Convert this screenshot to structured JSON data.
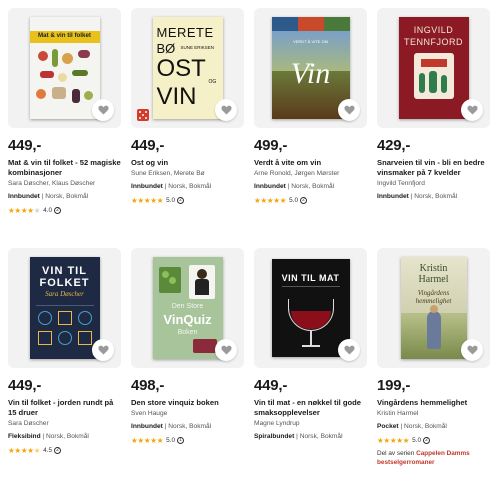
{
  "products": [
    {
      "price": "449,-",
      "title": "Mat & vin til folket - 52 magiske kombinasjoner",
      "authors": "Sara Døscher, Klaus Døscher",
      "format": "Innbundet",
      "language": "Norsk, Bokmål",
      "rating": "4.0",
      "rating_count": "2",
      "stars_filled": 4,
      "cover": {
        "title": "Mat & vin til folket",
        "bg": "#f4f4f0",
        "accent": "#e8c21a"
      }
    },
    {
      "price": "449,-",
      "title": "Ost og vin",
      "authors": "Sune Eriksen, Merete Bø",
      "format": "Innbundet",
      "language": "Norsk, Bokmål",
      "rating": "5.0",
      "rating_count": "2",
      "stars_filled": 5,
      "cover": {
        "line1": "MERETE",
        "line2": "BØ",
        "line2b": "SUNE ERIKSEN",
        "line3": "OST",
        "line4": "OG",
        "line5": "VIN",
        "bg": "#f6f0c8"
      }
    },
    {
      "price": "499,-",
      "title": "Verdt å vite om vin",
      "authors": "Arne Ronold, Jørgen Mørster",
      "format": "Innbundet",
      "language": "Norsk, Bokmål",
      "rating": "5.0",
      "rating_count": "2",
      "stars_filled": 5,
      "cover": {
        "title": "Vin",
        "sub": "VERDT Å VITE OM",
        "bg": "#6b3a1f"
      }
    },
    {
      "price": "429,-",
      "title": "Snarveien til vin - bli en bedre vinsmaker på 7 kvelder",
      "authors": "Ingvild Tennfjord",
      "format": "Innbundet",
      "language": "Norsk, Bokmål",
      "cover": {
        "line1": "INGVILD",
        "line2": "TENNFJORD",
        "bg": "#8b1a24"
      }
    },
    {
      "price": "449,-",
      "title": "Vin til folket - jorden rundt på 15 druer",
      "authors": "Sara Døscher",
      "format": "Fleksibind",
      "language": "Norsk, Bokmål",
      "rating": "4.5",
      "rating_count": "2",
      "stars_filled": 4,
      "cover": {
        "line1": "VIN TIL",
        "line2": "FOLKET",
        "line3": "Sara Døscher",
        "bg": "#1e2a44"
      }
    },
    {
      "price": "498,-",
      "title": "Den store vinquiz boken",
      "authors": "Sven Hauge",
      "format": "Innbundet",
      "language": "Norsk, Bokmål",
      "rating": "5.0",
      "rating_count": "1",
      "stars_filled": 5,
      "cover": {
        "line1": "Den Store",
        "line2": "VinQuiz",
        "line3": "Boken",
        "bg": "#a7c49a"
      }
    },
    {
      "price": "449,-",
      "title": "Vin til mat - en nøkkel til gode smaksopplevelser",
      "authors": "Magne Lyndrup",
      "format": "Spiralbundet",
      "language": "Norsk, Bokmål",
      "cover": {
        "title": "VIN TIL MAT",
        "bg": "#111111"
      }
    },
    {
      "price": "199,-",
      "title": "Vingårdens hemmelighet",
      "authors": "Kristin Harmel",
      "format": "Pocket",
      "language": "Norsk, Bokmål",
      "rating": "5.0",
      "rating_count": "2",
      "stars_filled": 5,
      "series_prefix": "Del av serien",
      "series_name": "Cappelen Damms bestselgerromaner",
      "cover": {
        "line1": "Kristin",
        "line2": "Harmel",
        "line3": "Vingårdens hemmelighet",
        "bg": "#d9d7b8"
      }
    }
  ],
  "colors": {
    "star": "#f0a80a",
    "series_link": "#c0392b"
  }
}
